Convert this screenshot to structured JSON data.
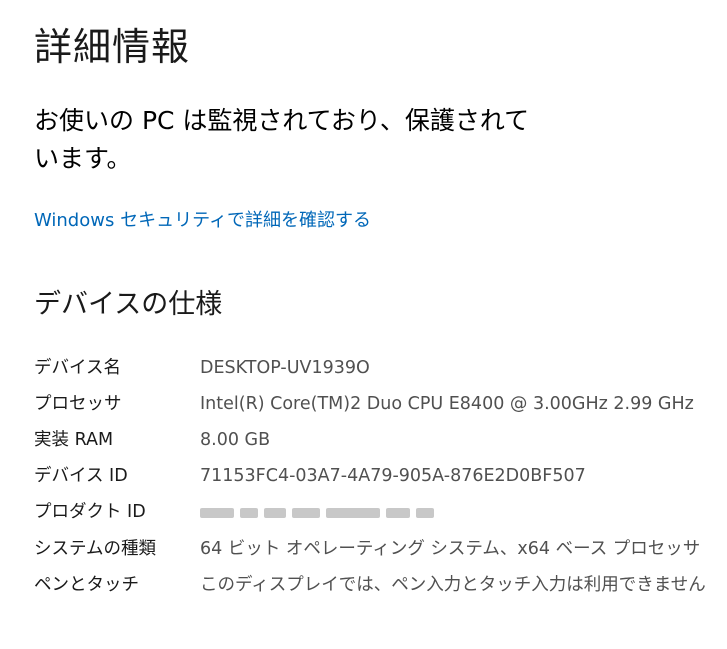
{
  "page": {
    "title": "詳細情報"
  },
  "protection": {
    "text": "お使いの PC は監視されており、保護されています。"
  },
  "security_link": {
    "label": "Windows セキュリティで詳細を確認する"
  },
  "device_spec": {
    "heading": "デバイスの仕様",
    "rows": [
      {
        "label": "デバイス名",
        "value": "DESKTOP-UV1939O"
      },
      {
        "label": "プロセッサ",
        "value": "Intel(R) Core(TM)2 Duo CPU     E8400  @ 3.00GHz   2.99 GHz"
      },
      {
        "label": "実装 RAM",
        "value": "8.00 GB"
      },
      {
        "label": "デバイス ID",
        "value": "71153FC4-03A7-4A79-905A-876E2D0BF507"
      },
      {
        "label": "プロダクト ID",
        "value": ""
      },
      {
        "label": "システムの種類",
        "value": "64 ビット オペレーティング システム、x64 ベース プロセッサ"
      },
      {
        "label": "ペンとタッチ",
        "value": "このディスプレイでは、ペン入力とタッチ入力は利用できません"
      }
    ]
  }
}
